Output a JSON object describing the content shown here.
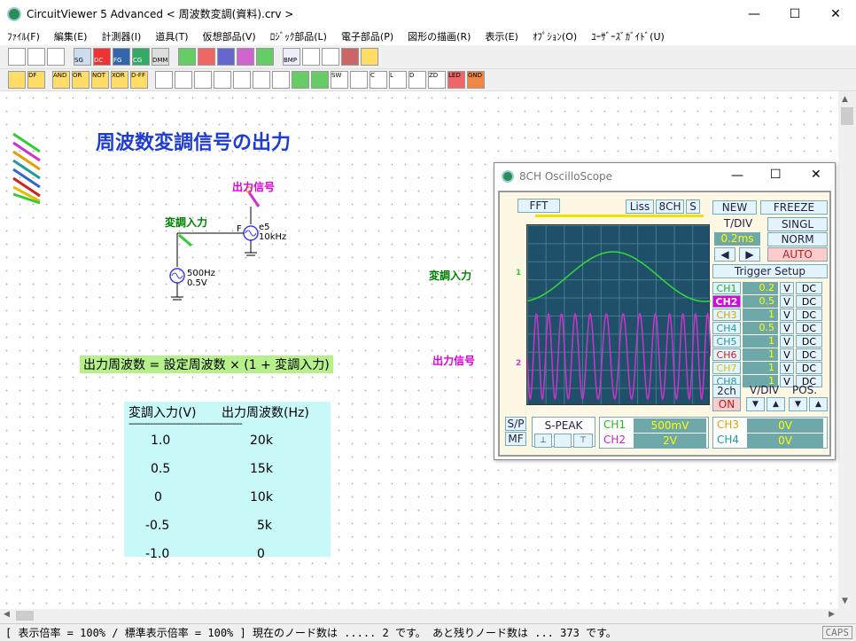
{
  "window": {
    "title": "CircuitViewer 5 Advanced  < 周波数変調(資料).crv >"
  },
  "menu": [
    "ﾌｧｲﾙ(F)",
    "編集(E)",
    "計測器(I)",
    "道具(T)",
    "仮想部品(V)",
    "ﾛｼﾞｯｸ部品(L)",
    "電子部品(P)",
    "図形の描画(R)",
    "表示(E)",
    "ｵﾌﾟｼｮﾝ(O)",
    "ﾕｰｻﾞｰｽﾞｶﾞｲﾄﾞ(U)"
  ],
  "toolbar1_icons": [
    "SG",
    "DC",
    "FG",
    "CG",
    "DMM",
    "BMP"
  ],
  "toolbar2_icons": [
    "DF",
    "AND",
    "OR",
    "NOT",
    "XOR",
    "D-FF",
    "SW",
    "C",
    "L",
    "D",
    "ZD",
    "LED",
    "GND"
  ],
  "diagram": {
    "heading": "周波数変調信号の出力",
    "label_output": "出力信号",
    "label_mod_input": "変調入力",
    "fm_source": {
      "prefix": "F",
      "name": "e5",
      "freq": "10kHz"
    },
    "mod_source": {
      "freq": "500Hz",
      "amp": "0.5V"
    },
    "formula": "出力周波数 = 設定周波数 × (1 + 変調入力)",
    "table": {
      "headers": [
        "変調入力(V)",
        "出力周波数(Hz)"
      ],
      "rule": "-------------------------------------------",
      "rows": [
        [
          "1.0",
          "20k"
        ],
        [
          "0.5",
          "15k"
        ],
        [
          "0",
          "10k"
        ],
        [
          "-0.5",
          "5k"
        ],
        [
          "-1.0",
          "0"
        ]
      ]
    },
    "side_label_mod": "変調入力",
    "side_label_out": "出力信号"
  },
  "scope": {
    "title": "8CH OscilloScope",
    "fft": "FFT",
    "liss": "Liss",
    "ch8": "8CH",
    "s": "S",
    "new": "NEW",
    "freeze": "FREEZE",
    "tdiv_label": "T/DIV",
    "tdiv_value": "0.2ms",
    "singl": "SINGL",
    "norm": "NORM",
    "auto": "AUTO",
    "trigger_setup": "Trigger Setup",
    "channels": [
      {
        "name": "CH1",
        "value": "0.2",
        "coupling": "DC",
        "color": "#22aa22"
      },
      {
        "name": "CH2",
        "value": "0.5",
        "coupling": "DC",
        "color": "#ffffff"
      },
      {
        "name": "CH3",
        "value": "1",
        "coupling": "DC",
        "color": "#e0a000"
      },
      {
        "name": "CH4",
        "value": "0.5",
        "coupling": "DC",
        "color": "#229999"
      },
      {
        "name": "CH5",
        "value": "1",
        "coupling": "DC",
        "color": "#229999"
      },
      {
        "name": "CH6",
        "value": "1",
        "coupling": "DC",
        "color": "#cc2222"
      },
      {
        "name": "CH7",
        "value": "1",
        "coupling": "DC",
        "color": "#e0c000"
      },
      {
        "name": "CH8",
        "value": "1",
        "coupling": "DC",
        "color": "#229999"
      }
    ],
    "v_label": "V",
    "twoch": "2ch",
    "on": "ON",
    "vdiv_label": "V/DIV",
    "pos_label": "POS.",
    "sp": "S/P",
    "mf": "MF",
    "speak": "S-PEAK",
    "bottom": [
      {
        "name": "CH1",
        "value": "500mV",
        "color": "#22bb22"
      },
      {
        "name": "CH2",
        "value": "2V",
        "color": "#cc22cc"
      },
      {
        "name": "CH3",
        "value": "0V",
        "color": "#e0a000"
      },
      {
        "name": "CH4",
        "value": "0V",
        "color": "#229999"
      }
    ],
    "trace_ch1_color": "#33dd33",
    "trace_ch2_color": "#cc33cc",
    "trace_marker_1": "1",
    "trace_marker_2": "2"
  },
  "status": {
    "text": "[ 表示倍率 = 100% / 標準表示倍率 = 100% ] 現在のノード数は ..... 2 です。 あと残りノード数は ... 373 です。",
    "caps": "CAPS"
  }
}
